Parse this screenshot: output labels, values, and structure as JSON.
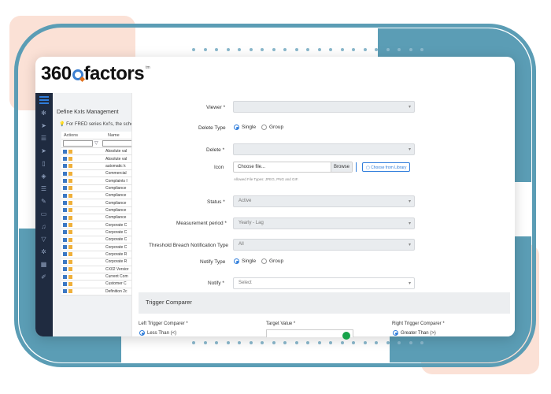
{
  "brand": {
    "logo_number": "360",
    "logo_word": "factors",
    "logo_tm": "tm",
    "accent": "#3c7fd0",
    "teal": "#5b9db5",
    "peach": "#fbe1d6"
  },
  "sidebar": {
    "icons": [
      "nodes-icon",
      "send-icon",
      "database-icon",
      "send-icon",
      "phone-icon",
      "shield-icon",
      "database-icon",
      "wrench-icon",
      "monitor-icon",
      "bell-icon",
      "filter-icon",
      "gear-icon",
      "grid-icon",
      "pencil-icon"
    ]
  },
  "background_page": {
    "title": "Define KxIs Management",
    "note": "For FRED series KxI's, the schedul",
    "table": {
      "headers": [
        "Actions",
        "Name"
      ],
      "rows": [
        "Absolute val",
        "Absolute val",
        "automatic k",
        "Commercial",
        "Complaints I",
        "Compliance",
        "Compliance",
        "Compliance",
        "Compliance",
        "Compliance",
        "Corporate C",
        "Corporate C",
        "Corporate C",
        "Corporate C",
        "Corporate R",
        "Corporate R",
        "CX02 Versior",
        "Current Com",
        "Customer C",
        "Definition 2c"
      ]
    }
  },
  "form": {
    "viewer": {
      "label": "Viewer",
      "value": ""
    },
    "delete_type": {
      "label": "Delete Type",
      "options": [
        "Single",
        "Group"
      ],
      "selected": "Single"
    },
    "delete": {
      "label": "Delete",
      "value": ""
    },
    "icon": {
      "label": "Icon",
      "file_placeholder": "Choose file...",
      "browse": "Browse",
      "library": "Choose from Library",
      "hint": "Allowed File Types: JPEG, PNG and GIF."
    },
    "status": {
      "label": "Status",
      "value": "Active"
    },
    "measurement_period": {
      "label": "Measurement period",
      "value": "Yearly - Lag"
    },
    "threshold": {
      "label": "Threshold Breach Notification Type",
      "value": "All"
    },
    "notify_type": {
      "label": "Notify Type",
      "options": [
        "Single",
        "Group"
      ],
      "selected": "Single"
    },
    "notify": {
      "label": "Notify",
      "value": "Select"
    },
    "trigger": {
      "section_title": "Trigger Comparer",
      "left_label": "Left Trigger Comparer",
      "left_value": "Less Than (<)",
      "target_label": "Target Value",
      "right_label": "Right Trigger Comparer",
      "right_value": "Greater Than (>)"
    }
  }
}
